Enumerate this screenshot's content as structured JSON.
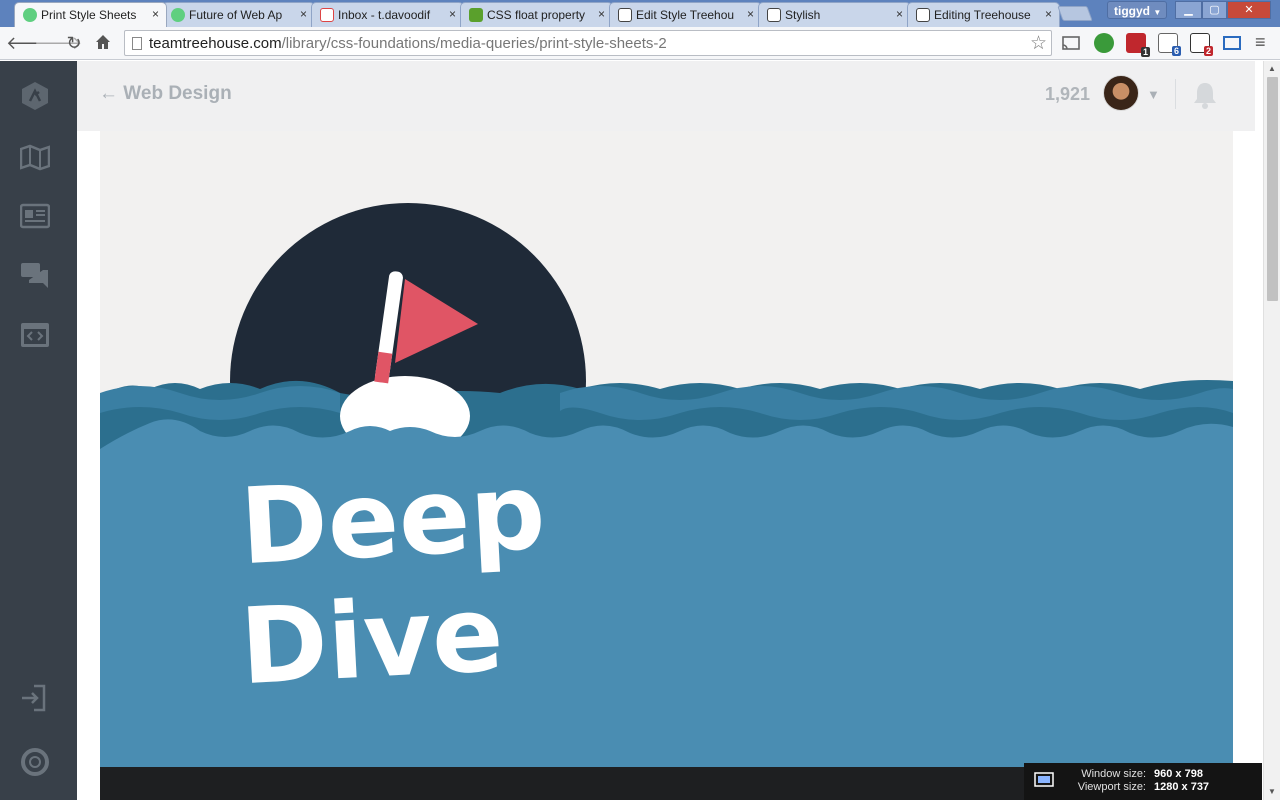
{
  "browser": {
    "tabs": [
      {
        "title": "Print Style Sheets",
        "favicon": "treehouse-icon",
        "active": true
      },
      {
        "title": "Future of Web Ap",
        "favicon": "treehouse-icon",
        "active": false
      },
      {
        "title": "Inbox - t.davoodif",
        "favicon": "gmail-icon",
        "active": false
      },
      {
        "title": "CSS float property",
        "favicon": "w3schools-icon",
        "active": false
      },
      {
        "title": "Edit Style Treehou",
        "favicon": "stylish-icon",
        "active": false
      },
      {
        "title": "Stylish",
        "favicon": "stylish-icon",
        "active": false
      },
      {
        "title": "Editing Treehouse",
        "favicon": "stylish-icon",
        "active": false
      }
    ],
    "close_glyph": "×",
    "profile_name": "tiggyd",
    "url_host": "teamtreehouse.com",
    "url_path": "/library/css-foundations/media-queries/print-style-sheets-2",
    "extension_badges": {
      "ext1": "1",
      "ext2": "6",
      "ext3": "2"
    }
  },
  "header": {
    "back_label": "Web Design",
    "points": "1,921"
  },
  "video": {
    "title_line1": "Deep",
    "title_line2": "Dive"
  },
  "overlay": {
    "window_label": "Window size:",
    "window_value": "960 x 798",
    "viewport_label": "Viewport size:",
    "viewport_value": "1280 x 737"
  },
  "colors": {
    "sidebar": "#384049",
    "sea_dark": "#2c6f8e",
    "sea_light": "#4a8db2",
    "moon": "#1f2a38",
    "flag": "#e05565"
  }
}
